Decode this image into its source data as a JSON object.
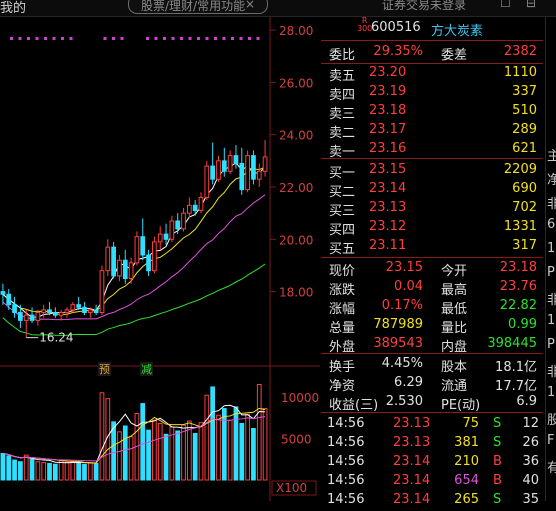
{
  "topbar": {
    "left_menu": "我的",
    "search_placeholder": "股票/理财/常用功能",
    "search_close": "×",
    "login_text": "证券交易未登录",
    "icons": [
      "message-icon",
      "settings-icon"
    ]
  },
  "chart": {
    "price_axis": [
      "28.00",
      "26.00",
      "24.00",
      "22.00",
      "20.00",
      "18.00"
    ],
    "low_label": "16.24",
    "markers": [
      {
        "text": "预",
        "color": "#e0a040"
      },
      {
        "text": "减",
        "color": "#2ee02e"
      }
    ],
    "volume_axis": [
      "10000",
      "5000"
    ],
    "volume_unit": "X100",
    "colors": {
      "up": "#ff3e3e",
      "down": "#2ee0ff",
      "ma5": "#ffffff",
      "ma10": "#f0e020",
      "ma20": "#e050e0",
      "ma60": "#2ee02e"
    }
  },
  "chart_data": {
    "type": "candlestick",
    "ylim": [
      15.5,
      28.5
    ],
    "candles": [
      [
        18.0,
        18.3,
        17.5,
        17.9
      ],
      [
        17.9,
        18.1,
        17.3,
        17.5
      ],
      [
        17.5,
        17.8,
        17.0,
        17.2
      ],
      [
        17.2,
        17.5,
        16.6,
        16.9
      ],
      [
        16.9,
        17.3,
        16.24,
        17.1
      ],
      [
        17.1,
        17.4,
        16.8,
        16.9
      ],
      [
        16.9,
        17.3,
        16.7,
        17.2
      ],
      [
        17.2,
        17.5,
        17.0,
        17.3
      ],
      [
        17.3,
        17.6,
        17.1,
        17.2
      ],
      [
        17.2,
        17.4,
        17.0,
        17.1
      ],
      [
        17.1,
        17.3,
        16.9,
        17.2
      ],
      [
        17.2,
        17.4,
        17.0,
        17.3
      ],
      [
        17.3,
        17.6,
        17.2,
        17.5
      ],
      [
        17.5,
        17.8,
        17.3,
        17.4
      ],
      [
        17.4,
        17.6,
        17.1,
        17.2
      ],
      [
        17.2,
        17.4,
        17.0,
        17.3
      ],
      [
        17.3,
        17.5,
        17.1,
        17.2
      ],
      [
        17.2,
        19.0,
        17.1,
        18.8
      ],
      [
        18.8,
        20.0,
        18.6,
        19.7
      ],
      [
        19.7,
        19.9,
        18.5,
        18.6
      ],
      [
        18.6,
        19.4,
        18.4,
        19.2
      ],
      [
        19.2,
        19.6,
        18.3,
        18.5
      ],
      [
        18.5,
        19.3,
        18.3,
        19.1
      ],
      [
        19.1,
        20.3,
        19.0,
        20.1
      ],
      [
        20.1,
        20.8,
        19.2,
        19.4
      ],
      [
        19.4,
        19.6,
        18.6,
        18.8
      ],
      [
        18.8,
        20.1,
        18.7,
        19.9
      ],
      [
        19.9,
        20.5,
        19.6,
        20.2
      ],
      [
        20.2,
        20.6,
        19.8,
        20.0
      ],
      [
        20.0,
        20.9,
        19.9,
        20.7
      ],
      [
        20.7,
        21.0,
        20.2,
        20.4
      ],
      [
        20.4,
        21.2,
        20.3,
        21.0
      ],
      [
        21.0,
        21.6,
        20.8,
        21.3
      ],
      [
        21.3,
        21.5,
        20.9,
        21.1
      ],
      [
        21.1,
        21.8,
        21.0,
        21.6
      ],
      [
        21.6,
        23.0,
        21.5,
        22.8
      ],
      [
        22.8,
        23.7,
        22.1,
        22.3
      ],
      [
        22.3,
        23.2,
        22.2,
        23.0
      ],
      [
        23.0,
        23.5,
        22.4,
        22.6
      ],
      [
        22.6,
        23.4,
        22.5,
        23.2
      ],
      [
        23.2,
        23.6,
        22.7,
        22.9
      ],
      [
        22.9,
        23.5,
        21.7,
        21.9
      ],
      [
        21.9,
        23.4,
        21.8,
        23.2
      ],
      [
        23.2,
        23.4,
        22.1,
        22.3
      ],
      [
        22.3,
        22.9,
        22.0,
        22.6
      ],
      [
        22.6,
        23.8,
        22.4,
        23.15
      ]
    ],
    "volume": [
      3200,
      2900,
      2400,
      2200,
      3000,
      2500,
      2200,
      2100,
      2000,
      1900,
      2300,
      2100,
      2200,
      2000,
      1900,
      2100,
      2000,
      10500,
      9800,
      7000,
      5800,
      6500,
      5200,
      8000,
      9200,
      6000,
      7200,
      6800,
      5500,
      6400,
      5900,
      6600,
      7100,
      5600,
      6900,
      10200,
      11200,
      7800,
      8600,
      7200,
      8800,
      6800,
      7900,
      6200,
      11500,
      8600
    ]
  },
  "quote": {
    "code": "600516",
    "name": "方大炭素",
    "badge_top": "R",
    "badge_bottom": "300",
    "webi_label": "委比",
    "webi_value": "29.35%",
    "wecha_label": "委差",
    "wecha_value": "2382",
    "asks": [
      {
        "label": "卖五",
        "price": "23.20",
        "vol": "1110"
      },
      {
        "label": "卖四",
        "price": "23.19",
        "vol": "337"
      },
      {
        "label": "卖三",
        "price": "23.18",
        "vol": "510"
      },
      {
        "label": "卖二",
        "price": "23.17",
        "vol": "289"
      },
      {
        "label": "卖一",
        "price": "23.16",
        "vol": "621"
      }
    ],
    "bids": [
      {
        "label": "买一",
        "price": "23.15",
        "vol": "2209"
      },
      {
        "label": "买二",
        "price": "23.14",
        "vol": "690"
      },
      {
        "label": "买三",
        "price": "23.13",
        "vol": "702"
      },
      {
        "label": "买四",
        "price": "23.12",
        "vol": "1331"
      },
      {
        "label": "买五",
        "price": "23.11",
        "vol": "317"
      }
    ],
    "stats": [
      {
        "l1": "现价",
        "v1": "23.15",
        "c1": "r",
        "l2": "今开",
        "v2": "23.18",
        "c2": "r"
      },
      {
        "l1": "涨跌",
        "v1": "0.04",
        "c1": "r",
        "l2": "最高",
        "v2": "23.76",
        "c2": "r"
      },
      {
        "l1": "涨幅",
        "v1": "0.17%",
        "c1": "r",
        "l2": "最低",
        "v2": "22.82",
        "c2": "g"
      },
      {
        "l1": "总量",
        "v1": "787989",
        "c1": "y",
        "l2": "量比",
        "v2": "0.99",
        "c2": "g"
      },
      {
        "l1": "外盘",
        "v1": "389543",
        "c1": "r",
        "l2": "内盘",
        "v2": "398445",
        "c2": "g"
      }
    ],
    "stats2": [
      {
        "l1": "换手",
        "v1": "4.45%",
        "l2": "股本",
        "v2": "18.1亿"
      },
      {
        "l1": "净资",
        "v1": "6.29",
        "l2": "流通",
        "v2": "17.7亿"
      },
      {
        "l1": "收益(三)",
        "v1": "2.530",
        "l2": "PE(动)",
        "v2": "6.9"
      }
    ],
    "ticks": [
      {
        "time": "14:56",
        "price": "23.13",
        "vol": "75",
        "vc": "y",
        "dir": "S",
        "n": "12"
      },
      {
        "time": "14:56",
        "price": "23.13",
        "vol": "381",
        "vc": "y",
        "dir": "S",
        "n": "26"
      },
      {
        "time": "14:56",
        "price": "23.14",
        "vol": "210",
        "vc": "y",
        "dir": "B",
        "n": "36"
      },
      {
        "time": "14:56",
        "price": "23.14",
        "vol": "654",
        "vc": "m",
        "dir": "B",
        "n": "40"
      },
      {
        "time": "14:56",
        "price": "23.14",
        "vol": "265",
        "vc": "y",
        "dir": "S",
        "n": "35"
      }
    ]
  },
  "edge_chars": [
    "主",
    "净",
    "非",
    "6",
    "1",
    "P",
    "非",
    "1",
    "P",
    "非",
    "1",
    "股",
    "F",
    "有"
  ]
}
